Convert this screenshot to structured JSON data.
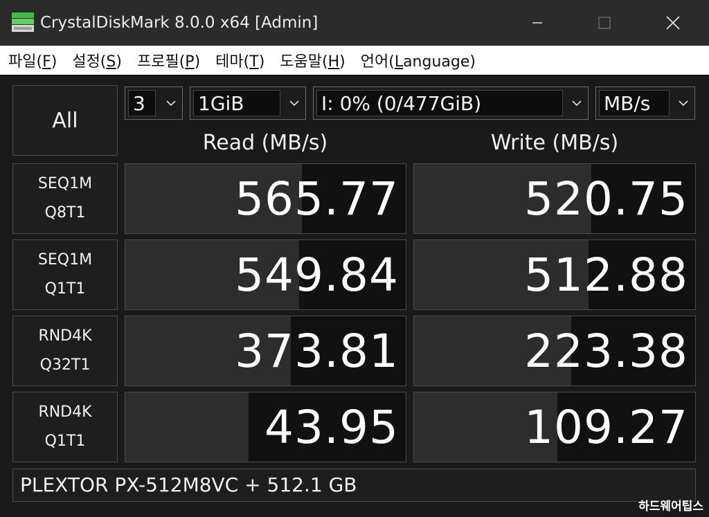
{
  "window": {
    "title": "CrystalDiskMark 8.0.0 x64 [Admin]"
  },
  "menu": [
    {
      "label": "파일(",
      "key": "F",
      "end": ")"
    },
    {
      "label": "설정(",
      "key": "S",
      "end": ")"
    },
    {
      "label": "프로필(",
      "key": "P",
      "end": ")"
    },
    {
      "label": "테마(",
      "key": "T",
      "end": ")"
    },
    {
      "label": "도움말(",
      "key": "H",
      "end": ")"
    },
    {
      "label": "언어(",
      "key": "L",
      "end": "anguage)"
    }
  ],
  "controls": {
    "all_label": "All",
    "count": "3",
    "size": "1GiB",
    "drive": "I: 0% (0/477GiB)",
    "unit": "MB/s"
  },
  "headers": {
    "read": "Read (MB/s)",
    "write": "Write (MB/s)"
  },
  "tests": [
    {
      "line1": "SEQ1M",
      "line2": "Q8T1",
      "read": "565.77",
      "write": "520.75",
      "read_fill": 0.63,
      "write_fill": 0.63
    },
    {
      "line1": "SEQ1M",
      "line2": "Q1T1",
      "read": "549.84",
      "write": "512.88",
      "read_fill": 0.62,
      "write_fill": 0.62
    },
    {
      "line1": "RND4K",
      "line2": "Q32T1",
      "read": "373.81",
      "write": "223.38",
      "read_fill": 0.59,
      "write_fill": 0.56
    },
    {
      "line1": "RND4K",
      "line2": "Q1T1",
      "read": "43.95",
      "write": "109.27",
      "read_fill": 0.44,
      "write_fill": 0.51
    }
  ],
  "device": "PLEXTOR PX-512M8VC + 512.1 GB",
  "watermark": "하드웨어팁스",
  "colors": {
    "background": "#1a1a1a",
    "bar": "#2d2d2d",
    "cell": "#111111",
    "text": "#ffffff"
  }
}
